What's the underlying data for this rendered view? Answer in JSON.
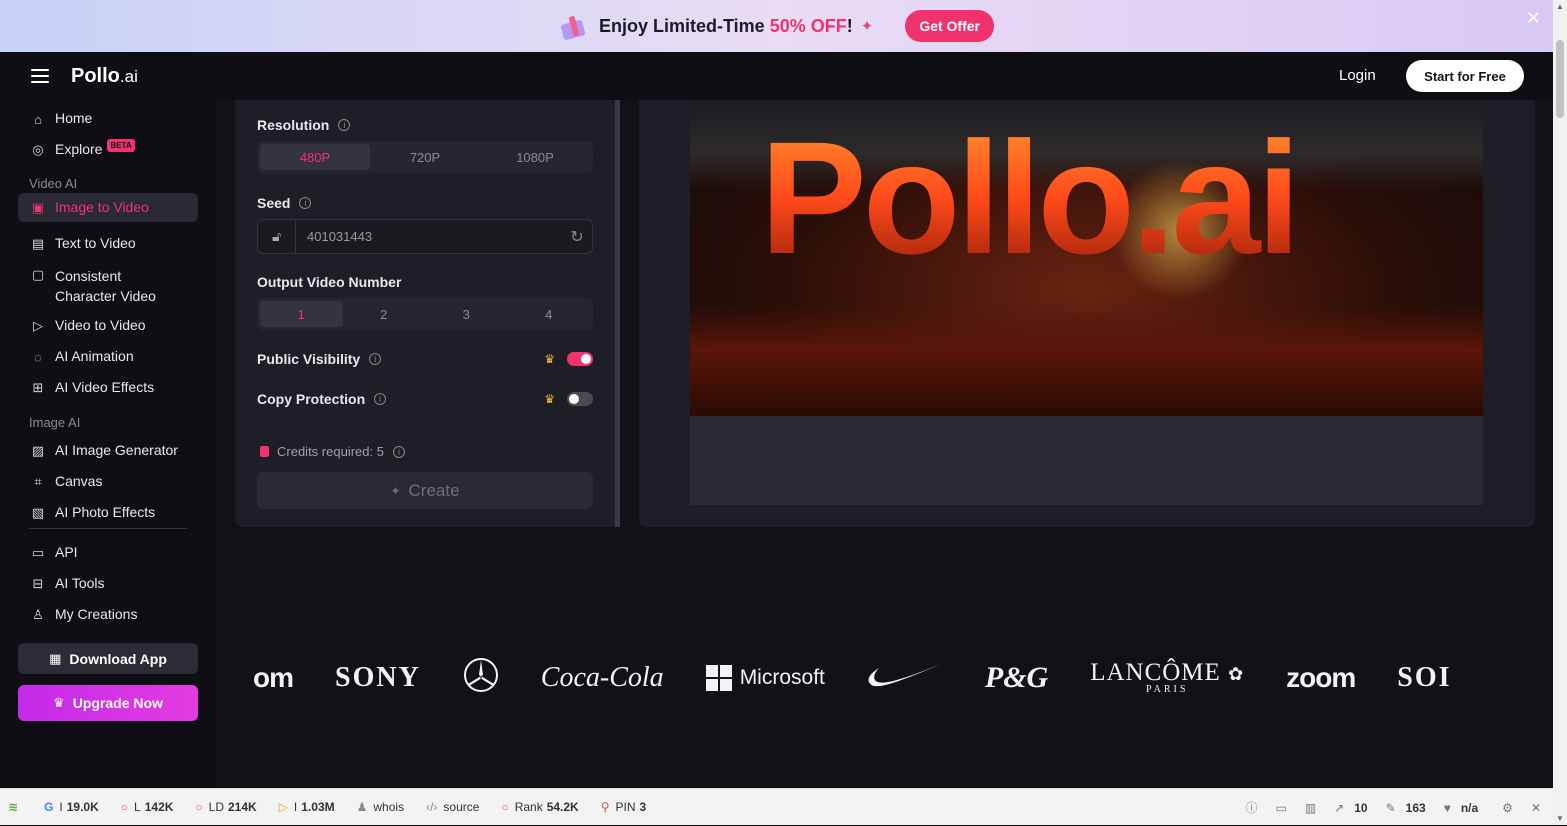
{
  "promo": {
    "text_before": "Enjoy Limited-Time ",
    "highlight": "50% OFF",
    "text_after": "!",
    "button": "Get Offer",
    "close": "✕"
  },
  "header": {
    "logo_main": "Pollo",
    "logo_suffix": ".ai",
    "login": "Login",
    "start": "Start for Free"
  },
  "sidebar": {
    "home": "Home",
    "explore": "Explore",
    "explore_badge": "BETA",
    "section_video": "Video AI",
    "video_items": [
      "Image to Video",
      "Text to Video",
      "Consistent Character Video",
      "Video to Video",
      "AI Animation",
      "AI Video Effects"
    ],
    "section_image": "Image AI",
    "image_items": [
      "AI Image Generator",
      "Canvas",
      "AI Photo Effects"
    ],
    "other_items": [
      "API",
      "AI Tools",
      "My Creations"
    ],
    "download": "Download App",
    "upgrade": "Upgrade Now"
  },
  "settings": {
    "resolution_label": "Resolution",
    "resolution_options": [
      "480P",
      "720P",
      "1080P"
    ],
    "resolution_selected": "480P",
    "seed_label": "Seed",
    "seed_value": "401031443",
    "output_label": "Output Video Number",
    "output_options": [
      "1",
      "2",
      "3",
      "4"
    ],
    "output_selected": "1",
    "public_label": "Public Visibility",
    "public_on": true,
    "copy_label": "Copy Protection",
    "copy_on": false,
    "credits": "Credits required: 5",
    "create": "Create"
  },
  "preview": {
    "video_text": "Pollo.ai"
  },
  "brands": [
    "om",
    "SONY",
    "Coca-Cola",
    "Microsoft",
    "P&G",
    "LANCÔME",
    "PARIS",
    "zoom",
    "SOI"
  ],
  "statusbar": {
    "items": [
      {
        "icon": "google-icon",
        "label": "I",
        "value": "19.0K"
      },
      {
        "icon": "circle-icon",
        "label": "L",
        "value": "142K"
      },
      {
        "icon": "circle-icon",
        "label": "LD",
        "value": "214K"
      },
      {
        "icon": "bing-icon",
        "label": "I",
        "value": "1.03M"
      },
      {
        "icon": "user-icon",
        "label": "whois",
        "value": ""
      },
      {
        "icon": "code-icon",
        "label": "source",
        "value": ""
      },
      {
        "icon": "circle-icon",
        "label": "Rank",
        "value": "54.2K"
      },
      {
        "icon": "pinterest-icon",
        "label": "PIN",
        "value": "3"
      }
    ],
    "right": [
      {
        "icon": "info-icon",
        "value": ""
      },
      {
        "icon": "monitor-icon",
        "value": ""
      },
      {
        "icon": "chart-icon",
        "value": ""
      },
      {
        "icon": "external-link-icon",
        "value": "10"
      },
      {
        "icon": "edit-icon",
        "value": "163"
      },
      {
        "icon": "heart-icon",
        "value": "n/a"
      }
    ]
  }
}
